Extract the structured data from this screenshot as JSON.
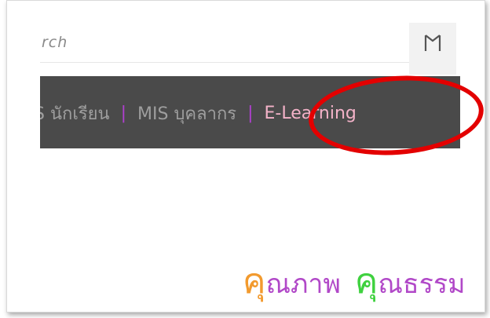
{
  "search": {
    "placeholder": "rch"
  },
  "nav": {
    "items": [
      {
        "label": "S นักเรียน"
      },
      {
        "label": "MIS บุคลากร"
      },
      {
        "label": "E-Learning"
      }
    ],
    "separator": "|",
    "highlighted_item": "E-Learning",
    "colors": {
      "background": "#4a4a4a",
      "text": "#9e9e9e",
      "separator": "#b03fd0",
      "active": "#f3b2c8",
      "highlight_circle": "#e30000"
    }
  },
  "motto": {
    "part1_cap": "คุ",
    "part1_rest": "ณภาพ",
    "part2_cap": "คุ",
    "part2_rest": "ณธรรม",
    "colors": {
      "cap1": "#f29a2e",
      "cap2": "#3fd13f",
      "rest": "#b148c8"
    }
  },
  "icons": {
    "search_button": "search-icon"
  }
}
